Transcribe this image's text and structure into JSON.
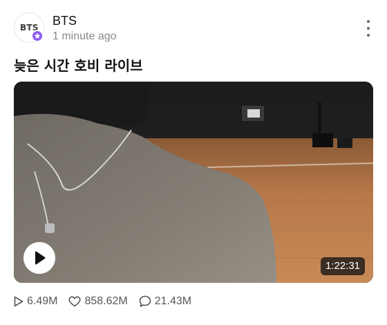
{
  "post": {
    "author": "BTS",
    "avatar_text": "BTS",
    "badge_icon": "star-icon",
    "timestamp": "1 minute ago",
    "title": "늦은 시간 호비 라이브"
  },
  "video": {
    "duration": "1:22:31"
  },
  "stats": {
    "views": "6.49M",
    "likes": "858.62M",
    "comments": "21.43M"
  },
  "colors": {
    "badge": "#8f5cf0",
    "text_secondary": "#8a8a8a",
    "stat_text": "#555555"
  }
}
